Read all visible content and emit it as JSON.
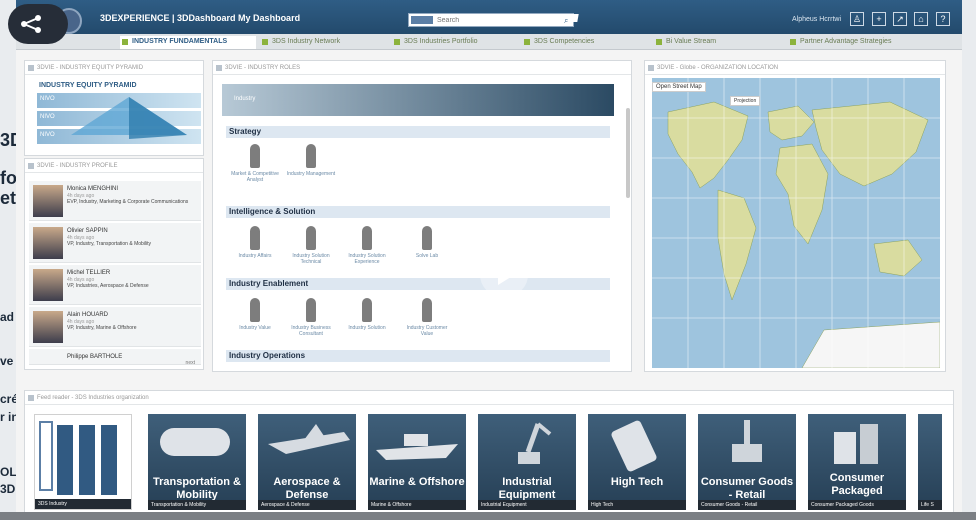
{
  "background": {
    "lines": [
      "3D",
      "fo",
      "et",
      "ad",
      "ve",
      "cré",
      "r in",
      "OL",
      "3D"
    ]
  },
  "header": {
    "brand": "3DEXPERIENCE | 3DDashboard  My Dashboard",
    "search_placeholder": "Search",
    "user": "Alpheus Hcrrtwi"
  },
  "tabs": [
    "INDUSTRY FUNDAMENTALS",
    "3DS Industry Network",
    "3DS Industries Portfolio",
    "3DS Competencies",
    "Bi Value Stream",
    "Partner Advantage Strategies"
  ],
  "left_panel": {
    "title": "3DVIE - INDUSTRY EQUITY PYRAMID",
    "pyramid_title": "INDUSTRY EQUITY PYRAMID",
    "levels": [
      "NIVO",
      "NIVO",
      "NIVO"
    ]
  },
  "profiles": {
    "title": "3DVIE - INDUSTRY PROFILE",
    "people": [
      {
        "name": "Monica MENGHINI",
        "time": "4h days ago",
        "role": "EVP, Industry, Marketing & Corporate Communications"
      },
      {
        "name": "Olivier SAPPIN",
        "time": "4h days ago",
        "role": "VP, Industry, Transportation & Mobility"
      },
      {
        "name": "Michel TELLIER",
        "time": "4h days ago",
        "role": "VP, Industries, Aerospace & Defense"
      },
      {
        "name": "Alain HOUARD",
        "time": "4h days ago",
        "role": "VP, Industry, Marine & Offshore"
      },
      {
        "name": "Philippe BARTHOLE",
        "time": "",
        "role": ""
      }
    ],
    "next": "next"
  },
  "roles": {
    "title": "3DVIE - INDUSTRY ROLES",
    "header": "Industry",
    "sections": [
      {
        "title": "Strategy",
        "roles": [
          "Market & Competitive Analyst",
          "Industry Management"
        ]
      },
      {
        "title": "Intelligence & Solution",
        "roles": [
          "Industry Affairs",
          "Industry Solution Technical",
          "Industry Solution Experience",
          "Solve Lab"
        ]
      },
      {
        "title": "Industry Enablement",
        "roles": [
          "Industry Value",
          "Industry Business Consultant",
          "Industry Solution",
          "Industry Customer Value"
        ]
      },
      {
        "title": "Industry Operations",
        "roles": []
      }
    ]
  },
  "map": {
    "title": "3DVIE - Globe - ORGANIZATION LOCATION",
    "street_view": "Open Street Map",
    "style": "Projection"
  },
  "feed": {
    "title": "Feed reader - 3DS Industries organization",
    "tiles": [
      {
        "title": "",
        "caption": "3DS Industry"
      },
      {
        "title": "Transportation & Mobility",
        "caption": "Transportation & Mobility"
      },
      {
        "title": "Aerospace & Defense",
        "caption": "Aerospace & Defense"
      },
      {
        "title": "Marine & Offshore",
        "caption": "Marine & Offshore"
      },
      {
        "title": "Industrial Equipment",
        "caption": "Industrial Equipment"
      },
      {
        "title": "High Tech",
        "caption": "High Tech"
      },
      {
        "title": "Consumer Goods - Retail",
        "caption": "Consumer Goods - Retail"
      },
      {
        "title": "Consumer Packaged",
        "caption": "Consumer Packaged Goods"
      },
      {
        "title": "",
        "caption": "Life S"
      }
    ]
  },
  "colors": {
    "header": "#2f5d85",
    "tile": "#3f5f7a",
    "accent": "#8cb33c"
  }
}
